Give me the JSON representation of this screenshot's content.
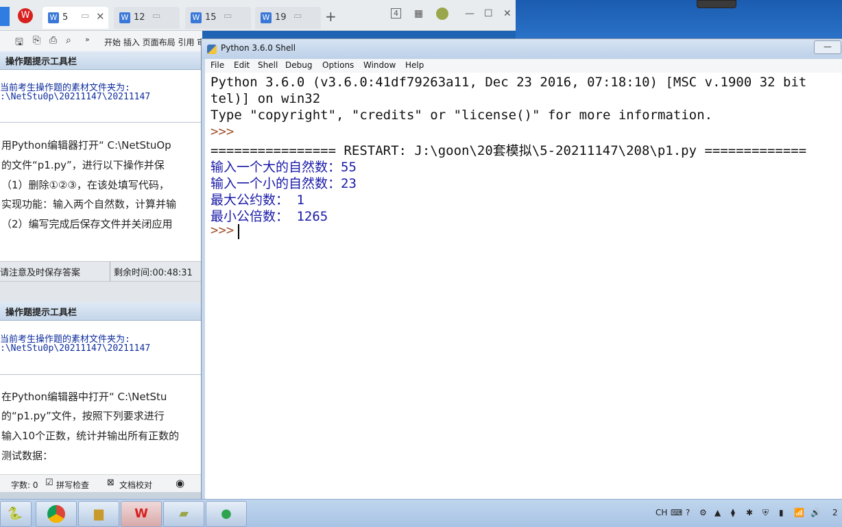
{
  "wps": {
    "tabs": [
      {
        "num": "5",
        "active": true
      },
      {
        "num": "12",
        "active": false
      },
      {
        "num": "15",
        "active": false
      },
      {
        "num": "19",
        "active": false
      }
    ],
    "plus": "+",
    "toolbar_menu": "开始 插入 页面布局 引用 审",
    "controls": {
      "count": "4"
    },
    "status": {
      "word_count": "字数: 0",
      "spell_check": "拼写检查",
      "doc_check": "文档校对"
    }
  },
  "panel1": {
    "header": "操作题提示工具栏",
    "folder_label": "当前考生操作题的素材文件夹为:",
    "folder_path": ":\\NetStu0p\\20211147\\20211147",
    "lines": [
      "用Python编辑器打开“ C:\\NetStuOp",
      "的文件“p1.py”，进行以下操作并保",
      "（1）删除①②③，在该处填写代码，",
      "实现功能：输入两个自然数，计算并输",
      "（2）编写完成后保存文件并关闭应用"
    ],
    "save_hint": "请注意及时保存答案",
    "time_left": "剩余时间:00:48:31"
  },
  "panel2": {
    "header": "操作题提示工具栏",
    "folder_label": "当前考生操作题的素材文件夹为:",
    "folder_path": ":\\NetStu0p\\20211147\\20211147",
    "lines": [
      "在Python编辑器中打开“ C:\\NetStu",
      "的“p1.py”文件，按照下列要求进行",
      "输入10个正数，统计并输出所有正数的",
      "测试数据："
    ]
  },
  "shell": {
    "title": "Python 3.6.0 Shell",
    "menu": [
      "File",
      "Edit",
      "Shell",
      "Debug",
      "Options",
      "Window",
      "Help"
    ],
    "minimize": "—",
    "lines": [
      {
        "text": "Python 3.6.0 (v3.6.0:41df79263a11, Dec 23 2016, 07:18:10) [MSC v.1900 32 bit",
        "style": "black"
      },
      {
        "text": "tel)] on win32",
        "style": "black"
      },
      {
        "text": "Type \"copyright\", \"credits\" or \"license()\" for more information.",
        "style": "black"
      },
      {
        "text": ">>> ",
        "style": "prompt"
      },
      {
        "text": "================ RESTART: J:\\goon\\20套模拟\\5-20211147\\208\\p1.py =============",
        "style": "black"
      },
      {
        "text": "输入一个大的自然数：55",
        "style": "blue"
      },
      {
        "text": "输入一个小的自然数：23",
        "style": "blue"
      },
      {
        "text": "最大公约数： 1",
        "style": "blue"
      },
      {
        "text": "最小公倍数： 1265",
        "style": "blue"
      },
      {
        "text": ">>> ",
        "style": "prompt"
      }
    ]
  },
  "taskbar": {
    "apps": [
      "python-idle",
      "chrome",
      "file-explorer",
      "wps",
      "notes",
      "wechat"
    ],
    "tray": {
      "lang": "CH",
      "clock": "2"
    }
  }
}
